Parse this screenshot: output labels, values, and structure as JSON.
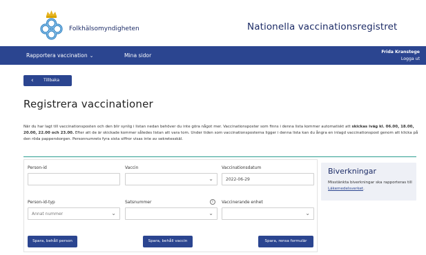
{
  "header": {
    "org_name": "Folkhälsomyndigheten",
    "site_title": "Nationella vaccinationsregistret"
  },
  "nav": {
    "report_vaccination": "Rapportera vaccination",
    "my_pages": "Mina sidor",
    "user_name": "Frida Kranstege",
    "logout": "Logga ut"
  },
  "back_label": "Tillbaka",
  "page_title": "Registrera vaccinationer",
  "info": {
    "part1": "När du har lagt till vaccinationsposten och den blir synlig i listan nedan behöver du inte göra något mer. Vaccinationsposter som finns i denna lista kommer automatiskt att ",
    "bold": "skickas iväg kl. 06.00, 18.00, 20.00, 22.00 och 23.00.",
    "part2": " Efter att de är skickade kommer således listan att vara tom. Under tiden som vaccinationsposterna ligger i denna lista kan du ångra en inlagd vaccinationspost genom att klicka på den röda papperskorgen. Personnumrets fyra sista siffror visas inte av sekretesskäl."
  },
  "form": {
    "person_id_label": "Person-id",
    "person_id_value": "",
    "vaccine_label": "Vaccin",
    "vaccine_value": "",
    "date_label": "Vaccinationsdatum",
    "date_value": "2022-06-29",
    "person_id_type_label": "Person-id-typ",
    "person_id_type_value": "Annat nummer",
    "batch_label": "Satsnummer",
    "batch_value": "",
    "unit_label": "Vaccinerande enhet",
    "unit_value": ""
  },
  "buttons": {
    "save_keep_person": "Spara, behåll person",
    "save_keep_vaccine": "Spara, behåll vaccin",
    "save_clear_form": "Spara, rensa formulär"
  },
  "side": {
    "title": "Biverkningar",
    "text": "Misstänkta biverkningar ska rapporteras till ",
    "link": "Läkemedelsverket",
    "suffix": "."
  },
  "colors": {
    "brand_blue": "#2b4590",
    "navy_text": "#1c2b66",
    "teal_divider": "#2a9d8f",
    "logo_gold": "#e6b422"
  },
  "icons": {
    "logo": "crowned-rings-logo",
    "nav_chevron": "chevron-down-icon",
    "back": "chevron-left-icon",
    "select": "chevron-down-icon",
    "help": "info-circle-icon"
  }
}
